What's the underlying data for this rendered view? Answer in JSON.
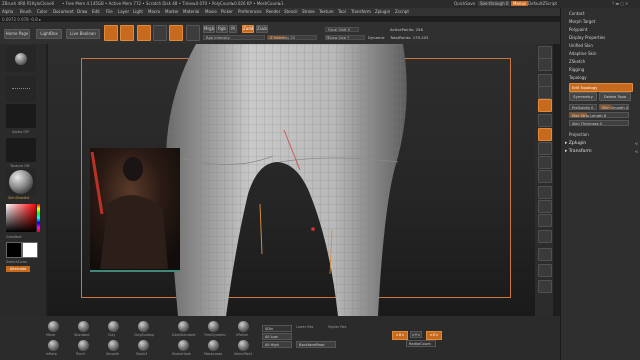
{
  "titlebar": {
    "app": "ZBrush 4R8 P2",
    "doc": "KyloClone6",
    "mem": "• Free Mem 4.145GB • Active Mem 772 • Scratch Disk 48 • Timer▸0.070 • PolyCount▸0.026 KP • MeshCount▸1",
    "quicksave": "QuickSave",
    "see_through": "See-through 0",
    "menus_btn": "Menus",
    "default_script": "DefaultZScript"
  },
  "menubar": [
    "Alpha",
    "Brush",
    "Color",
    "Document",
    "Draw",
    "Edit",
    "File",
    "Layer",
    "Light",
    "Macro",
    "Marker",
    "Material",
    "Movie",
    "Picker",
    "Preferences",
    "Render",
    "Stencil",
    "Stroke",
    "Texture",
    "Tool",
    "Transform",
    "Zplugin",
    "Zscript"
  ],
  "coord": "0.6972 0.978 -0.8 ▸",
  "shelf": {
    "home_page": "Home Page",
    "lightbox": "LightBox",
    "live_boolean": "Live Boolean",
    "tools": [
      {
        "name": "edit-icon",
        "label": "Edit",
        "active": true
      },
      {
        "name": "draw-icon",
        "label": "Draw",
        "active": true
      },
      {
        "name": "move-icon",
        "label": "Move",
        "active": false
      },
      {
        "name": "scale-icon",
        "label": "Scale",
        "active": false
      },
      {
        "name": "rotate-icon",
        "label": "Rotate",
        "active": false
      }
    ],
    "mrgb": "Mrgb",
    "rgb": "Rgb",
    "m": "M",
    "zadd": "Zadd",
    "zsub": "Zsub",
    "zcut": "Zcut",
    "rgb_intensity": "Rgb Intensity",
    "z_intensity": "Z Intensity 25",
    "focal_shift": "Focal Shift 0",
    "draw_size": "Draw Size 7",
    "dynamic": "Dynamic",
    "active_points": "ActivePoints: 256",
    "total_points": "TotalPoints: 179.203"
  },
  "lefttray": {
    "alpha_label": "Alpha Off",
    "texture_label": "Texture Off",
    "material_label": "SkinShade4",
    "gradient_label": "Gradient",
    "switch_color": "SwitchColor",
    "alternate": "Alternate"
  },
  "rightstrip": [
    {
      "name": "bpr-icon",
      "label": "BPR",
      "active": false
    },
    {
      "name": "spix-icon",
      "label": "SPix 3",
      "active": false
    },
    {
      "name": "scroll-icon",
      "label": "Scroll",
      "active": false
    },
    {
      "name": "zoom-icon",
      "label": "Zoom",
      "active": false
    },
    {
      "name": "actual-icon",
      "label": "Actual",
      "active": true
    },
    {
      "name": "aahalf-icon",
      "label": "AAHalf",
      "active": false
    },
    {
      "name": "persp-icon",
      "label": "Persp",
      "active": true
    },
    {
      "name": "floor-icon",
      "label": "Floor",
      "active": false
    },
    {
      "name": "local-icon",
      "label": "Local",
      "active": false
    },
    {
      "name": "xyz-icon",
      "label": "Xyz",
      "active": false
    },
    {
      "name": "frame-icon",
      "label": "Frame",
      "active": false
    },
    {
      "name": "move-view-icon",
      "label": "Move",
      "active": false
    },
    {
      "name": "zoom3d-icon",
      "label": "Zoom3D",
      "active": false
    },
    {
      "name": "rotate-view-icon",
      "label": "Rotate",
      "active": false
    },
    {
      "name": "polyf-icon",
      "label": "PolyF",
      "active": false
    },
    {
      "name": "transp-icon",
      "label": "Transp",
      "active": false
    },
    {
      "name": "solo-icon",
      "label": "Solo",
      "active": false
    }
  ],
  "rpanel": {
    "items": [
      "Contact",
      "Morph Target",
      "Polypaint",
      "Display Properties",
      "Unified Skin",
      "Adaptive Skin",
      "ZSketch",
      "Rigging",
      "Topology"
    ],
    "edit_topology": "Edit Topology",
    "symmetry": "Symmetry",
    "delete_topo": "Delete Topo",
    "pre_subdiv": "PreSubdiv 0",
    "skin_smooth": "Skin Smooth 4",
    "max_strip_length": "Max Strip Length 8",
    "skin_thickness": "Skin Thickness 0",
    "projection": "Projection",
    "zplugin": "Zplugin",
    "transform": "Transform"
  },
  "bottom": {
    "brushes": [
      "Move",
      "Standard",
      "Clay",
      "ClayBuildup",
      "DamStandard",
      "TrimDynamic",
      "hPolish",
      "Inflate",
      "Pinch",
      "Smooth",
      "Slash3",
      "SnakeHook",
      "MaskLasso",
      "SelectRect",
      "Sphere"
    ],
    "all_low": "All Low",
    "all_high": "All High",
    "lower_res": "Lower Res",
    "higher_res": "Higher Res",
    "backface_mask": "BackfaceMask",
    "sdiv": "SDiv",
    "zx": ">X<",
    "zy": ">Y<",
    "zz": ">Z<",
    "radial_count": "RadialCount"
  },
  "colors": {
    "accent": "#c86a1e",
    "panel": "#2f2f2f",
    "canvas": "#262626"
  }
}
